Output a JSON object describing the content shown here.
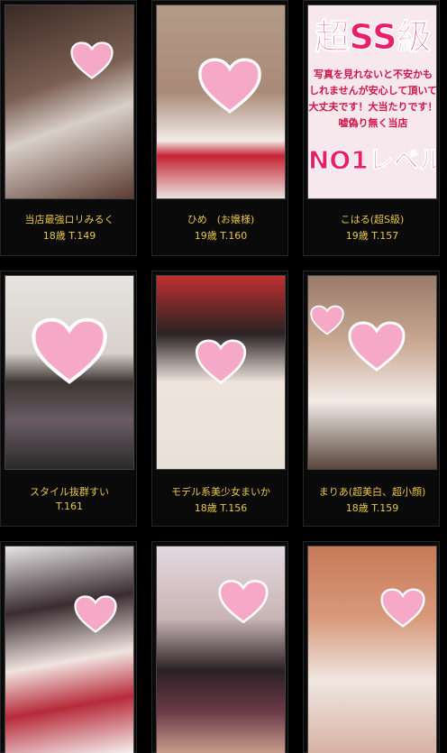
{
  "colors": {
    "background": "#000000",
    "card_text": "#e8c547",
    "heart_pink": "#f6a9c6"
  },
  "cards": [
    {
      "name": "当店最強ロリみるく",
      "meta": "18歳 T.149"
    },
    {
      "name": "ひめ　(お嬢様)",
      "meta": "19歳 T.160"
    },
    {
      "name": "こはる(超S級)",
      "meta": "19歳 T.157"
    },
    {
      "name": "スタイル抜群すい",
      "meta": "T.161"
    },
    {
      "name": "モデル系美少女まいか",
      "meta": "18歳 T.156"
    },
    {
      "name": "まりあ(超美白、超小顔)",
      "meta": "18歳 T.159"
    },
    {
      "name": "",
      "meta": ""
    },
    {
      "name": "",
      "meta": ""
    },
    {
      "name": "",
      "meta": ""
    }
  ],
  "banner": {
    "headline": "超SS級",
    "lines": [
      "写真を見れないと不安かも",
      "しれませんが安心して頂いて",
      "大丈夫です！大当たりです！",
      "嘘偽り無く当店"
    ],
    "footer": "NO1レベル！"
  },
  "icons": {
    "face_cover": "heart-icon"
  }
}
